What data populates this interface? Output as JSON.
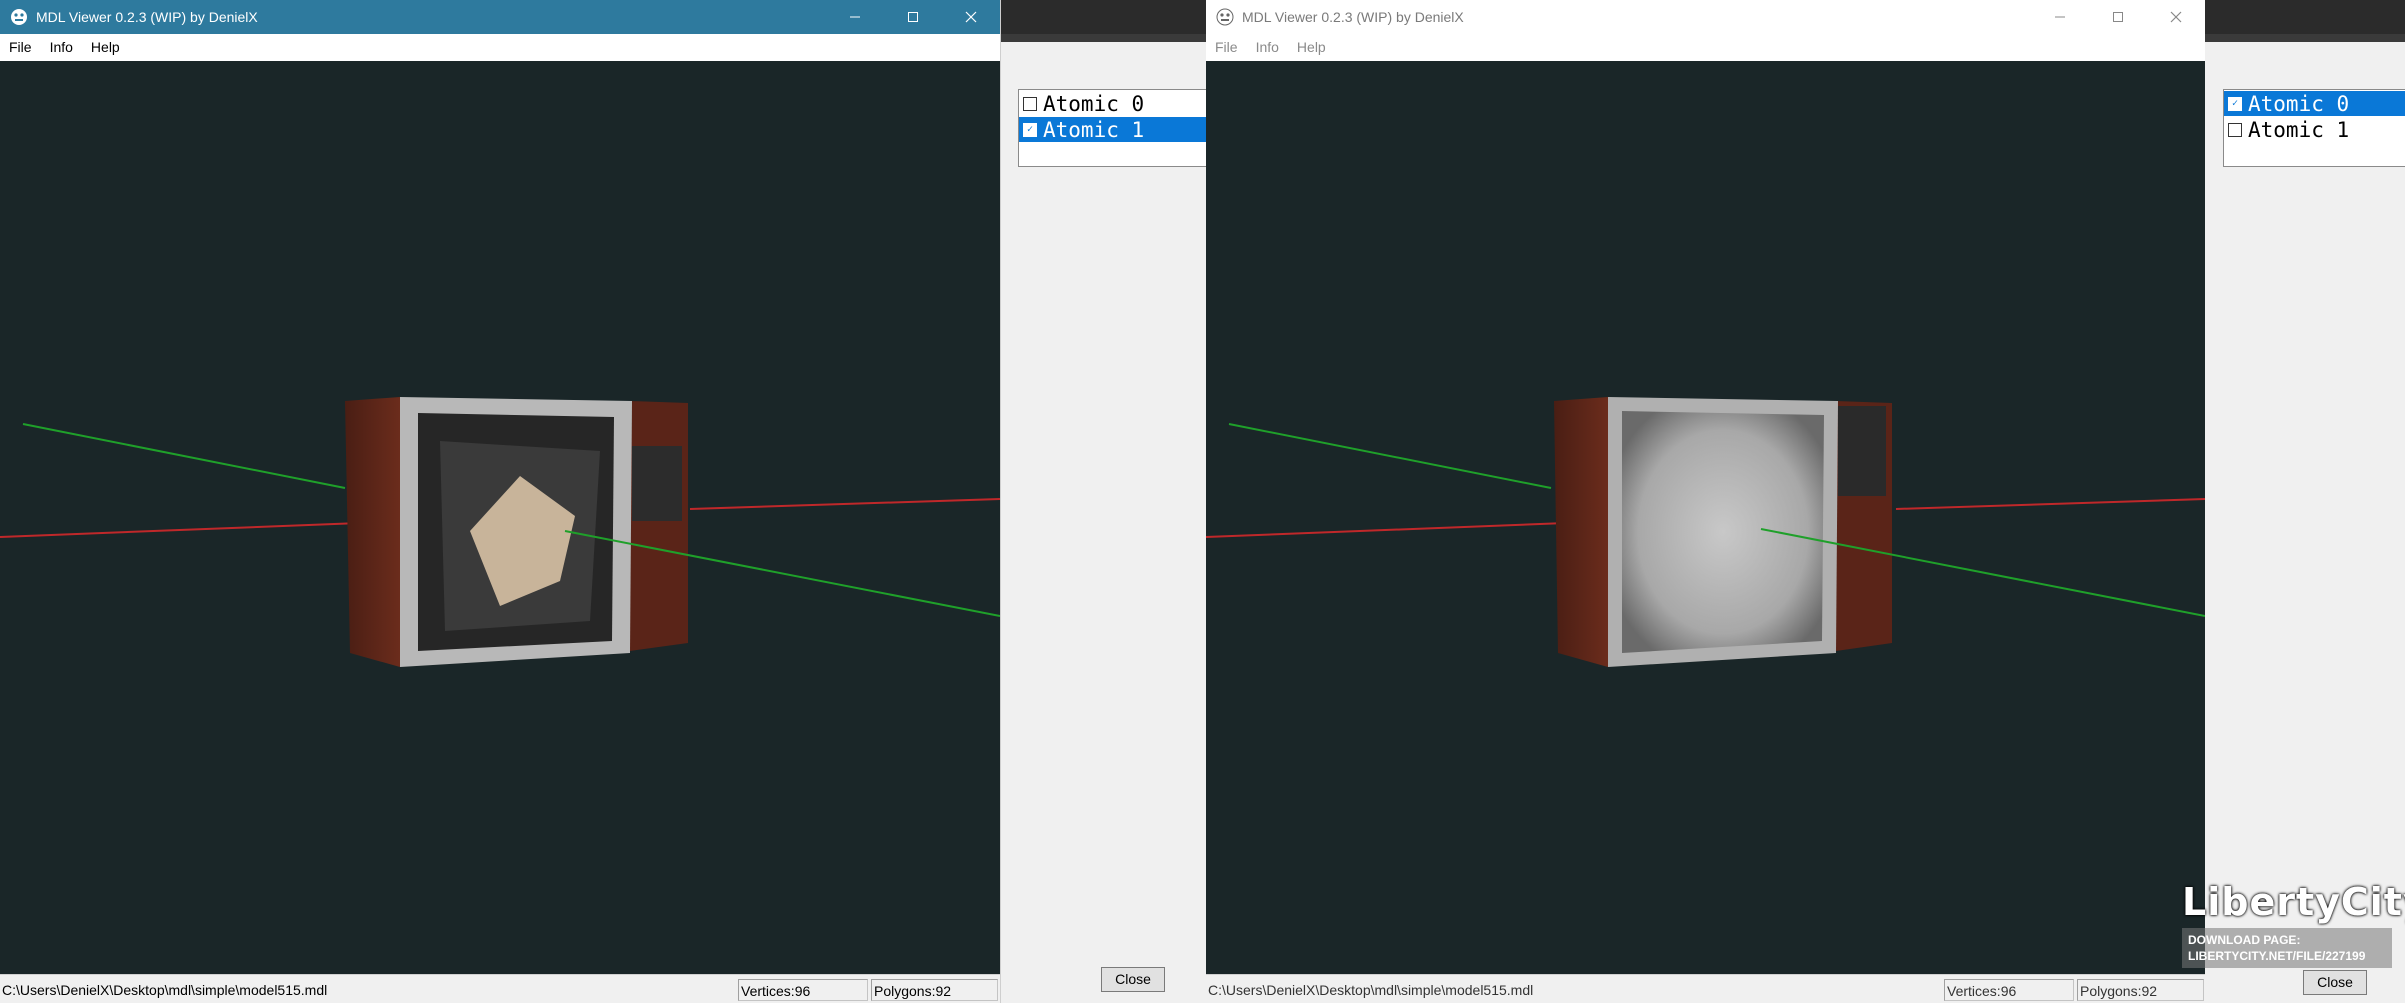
{
  "windows": [
    {
      "title": "MDL Viewer 0.2.3 (WIP) by DenielX",
      "menu": [
        "File",
        "Info",
        "Help"
      ],
      "status": {
        "path": "C:\\Users\\DenielX\\Desktop\\mdl\\simple\\model515.mdl",
        "vertices": "Vertices:96",
        "polygons": "Polygons:92"
      },
      "atomics": [
        {
          "label": "Atomic 0",
          "checked": false,
          "selected": false
        },
        {
          "label": "Atomic 1",
          "checked": true,
          "selected": true
        }
      ],
      "close_label": "Close",
      "active": true
    },
    {
      "title": "MDL Viewer 0.2.3 (WIP) by DenielX",
      "menu": [
        "File",
        "Info",
        "Help"
      ],
      "status": {
        "path": "C:\\Users\\DenielX\\Desktop\\mdl\\simple\\model515.mdl",
        "vertices": "Vertices:96",
        "polygons": "Polygons:92"
      },
      "atomics": [
        {
          "label": "Atomic 0",
          "checked": true,
          "selected": true
        },
        {
          "label": "Atomic 1",
          "checked": false,
          "selected": false
        }
      ],
      "close_label": "Close",
      "active": false
    }
  ],
  "watermark": {
    "logo": "LibertyCity",
    "line1": "DOWNLOAD PAGE:",
    "line2": "LIBERTYCITY.NET/FILE/227199"
  },
  "colors": {
    "active_title": "#2e7a9e",
    "viewport_bg": "#1a2628",
    "selection": "#0a78d7",
    "axis_x": "#c0282a",
    "axis_y": "#1fa02a"
  }
}
